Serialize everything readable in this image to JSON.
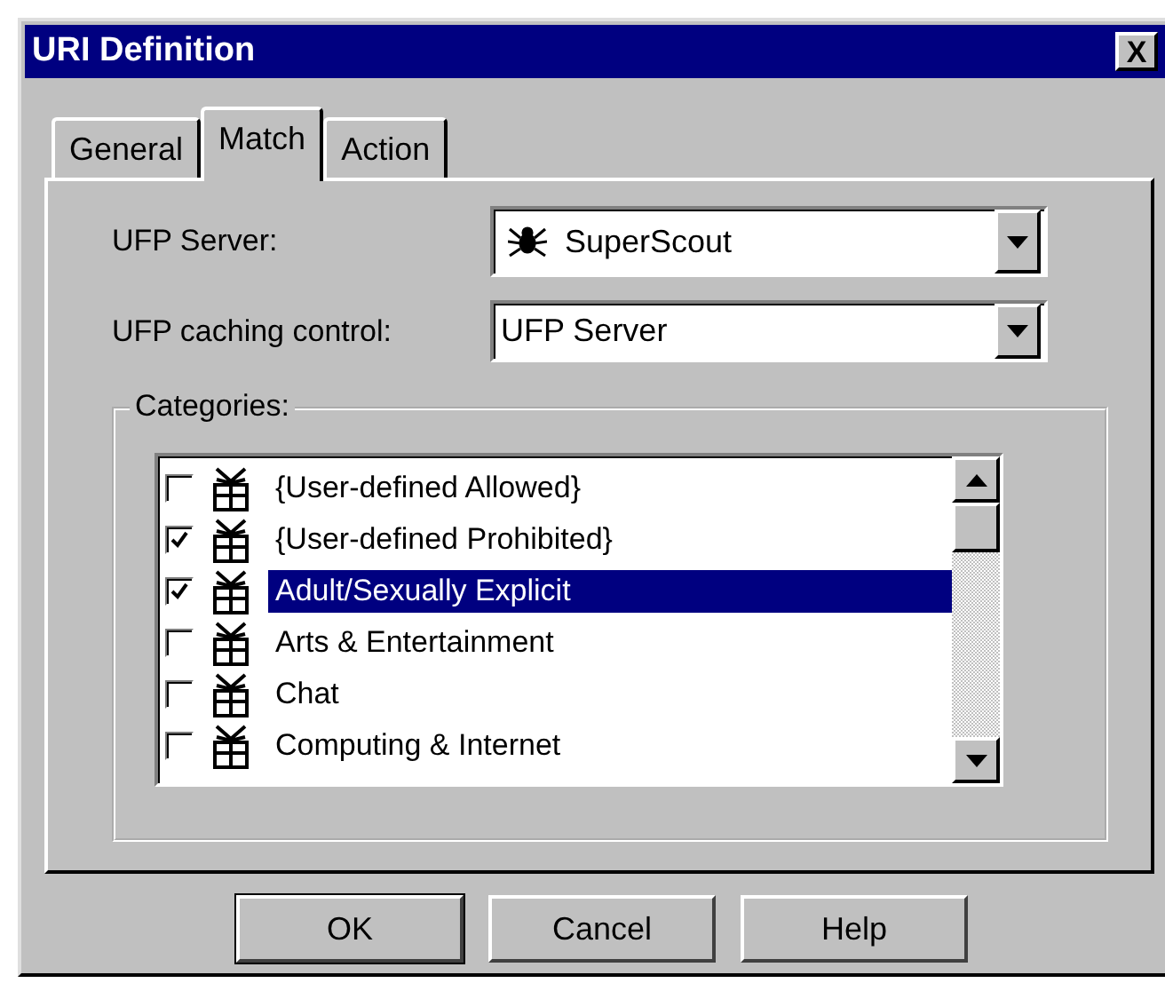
{
  "window": {
    "title": "URI Definition",
    "close": "X"
  },
  "tabs": [
    {
      "label": "General",
      "selected": false
    },
    {
      "label": "Match",
      "selected": true
    },
    {
      "label": "Action",
      "selected": false
    }
  ],
  "ufp_server": {
    "label": "UFP Server:",
    "value": "SuperScout"
  },
  "ufp_caching_control": {
    "label": "UFP caching control:",
    "value": "UFP Server"
  },
  "categories": {
    "label": "Categories:",
    "items": [
      {
        "label": "{User-defined Allowed}",
        "checked": false,
        "selected": false
      },
      {
        "label": "{User-defined Prohibited}",
        "checked": true,
        "selected": false
      },
      {
        "label": "Adult/Sexually Explicit",
        "checked": true,
        "selected": true
      },
      {
        "label": "Arts & Entertainment",
        "checked": false,
        "selected": false
      },
      {
        "label": "Chat",
        "checked": false,
        "selected": false
      },
      {
        "label": "Computing & Internet",
        "checked": false,
        "selected": false
      }
    ]
  },
  "buttons": [
    {
      "label": "OK",
      "default": true
    },
    {
      "label": "Cancel",
      "default": false
    },
    {
      "label": "Help",
      "default": false
    }
  ]
}
